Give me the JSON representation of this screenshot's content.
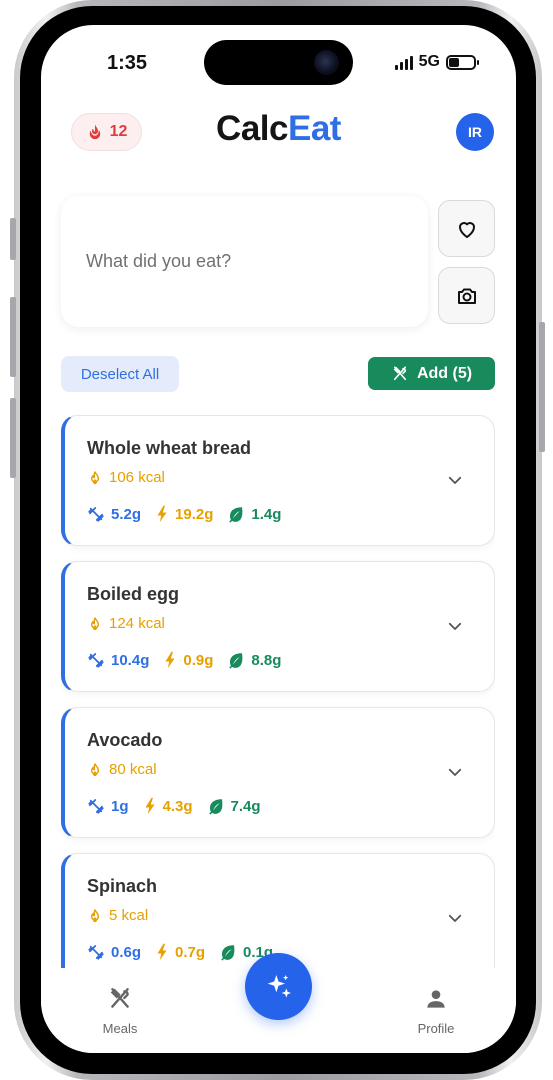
{
  "status_bar": {
    "time": "1:35",
    "network": "5G"
  },
  "header": {
    "streak_count": "12",
    "brand_part1": "Calc",
    "brand_part2": "Eat",
    "avatar_initials": "IR"
  },
  "input": {
    "placeholder": "What did you eat?"
  },
  "actions": {
    "deselect_label": "Deselect All",
    "add_label": "Add (5)"
  },
  "foods": [
    {
      "name": "Whole wheat bread",
      "kcal": "106 kcal",
      "protein": "5.2g",
      "carbs": "19.2g",
      "fat": "1.4g"
    },
    {
      "name": "Boiled egg",
      "kcal": "124 kcal",
      "protein": "10.4g",
      "carbs": "0.9g",
      "fat": "8.8g"
    },
    {
      "name": "Avocado",
      "kcal": "80 kcal",
      "protein": "1g",
      "carbs": "4.3g",
      "fat": "7.4g"
    },
    {
      "name": "Spinach",
      "kcal": "5 kcal",
      "protein": "0.6g",
      "carbs": "0.7g",
      "fat": "0.1g"
    }
  ],
  "nav": {
    "meals_label": "Meals",
    "profile_label": "Profile"
  },
  "colors": {
    "brand_blue": "#2f6fe4",
    "green": "#188a5c",
    "amber": "#e6a000",
    "streak_red": "#e23b3b"
  },
  "icons": {
    "streak": "flame-icon",
    "favorite": "heart-icon",
    "camera": "camera-icon",
    "add": "utensils-icon",
    "kcal": "flame-outline-icon",
    "protein": "dumbbell-icon",
    "carbs": "lightning-icon",
    "fat": "leaf-icon",
    "expand": "chevron-down-icon",
    "fab": "sparkles-icon",
    "meals": "utensils-icon",
    "profile": "person-icon"
  }
}
